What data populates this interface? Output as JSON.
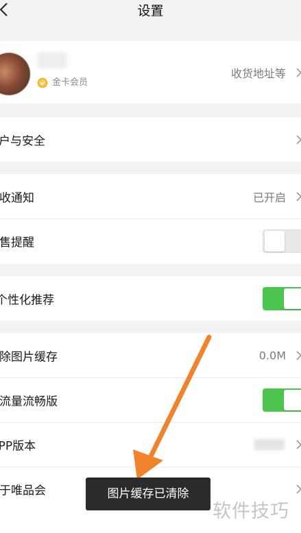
{
  "header": {
    "title": "设置",
    "back_icon": "chevron-left-icon"
  },
  "profile": {
    "membership": "金卡会员",
    "address_link": "收货地址等",
    "membership_icon": "gold-badge-icon"
  },
  "account": {
    "label": "户与安全"
  },
  "notifications": {
    "receive_label": "接收通知",
    "receive_value": "已开启",
    "presale_label": "开售提醒",
    "presale_enabled": false
  },
  "personalization": {
    "label": "个性化推荐",
    "enabled": true
  },
  "storage": {
    "clear_cache_label": "清除图片缓存",
    "clear_cache_value": "0.0M",
    "lite_mode_label": "省流量流畅版",
    "lite_mode_enabled": true,
    "version_label": "APP版本",
    "about_label": "关于唯品会"
  },
  "toast": {
    "message": "图片缓存已清除"
  },
  "watermark": {
    "text": "软件技巧"
  },
  "colors": {
    "background": "#f2f2f4",
    "toggle_on": "#4cc54f",
    "toggle_off": "#e9e9ea",
    "arrow": "#f0832c",
    "toast_bg": "#2b2b2b"
  }
}
